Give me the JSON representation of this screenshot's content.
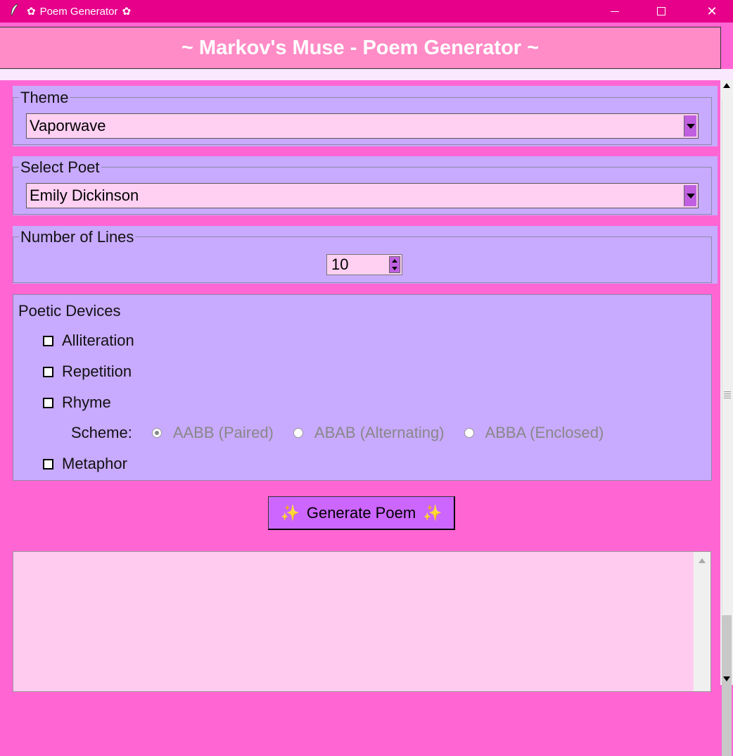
{
  "window": {
    "title": "Poem Generator",
    "title_flower": "✿",
    "app_icon": "feather-icon"
  },
  "header": {
    "title": "~ Markov's Muse - Poem Generator ~"
  },
  "theme": {
    "legend": "Theme",
    "selected": "Vaporwave"
  },
  "poet": {
    "legend": "Select Poet",
    "selected": "Emily Dickinson"
  },
  "lines": {
    "legend": "Number of Lines",
    "value": "10"
  },
  "devices": {
    "title": "Poetic Devices",
    "alliteration": "Alliteration",
    "repetition": "Repetition",
    "rhyme": "Rhyme",
    "metaphor": "Metaphor",
    "scheme_label": "Scheme:",
    "schemes": [
      "AABB (Paired)",
      "ABAB (Alternating)",
      "ABBA (Enclosed)"
    ]
  },
  "actions": {
    "generate": "Generate Poem",
    "sparkle": "✨"
  },
  "colors": {
    "titlebar": "#e6008a",
    "header": "#ff8cc6",
    "background": "#ff66d4",
    "panel": "#c8aaff",
    "field": "#ffd0f2",
    "button": "#cc66ff"
  }
}
